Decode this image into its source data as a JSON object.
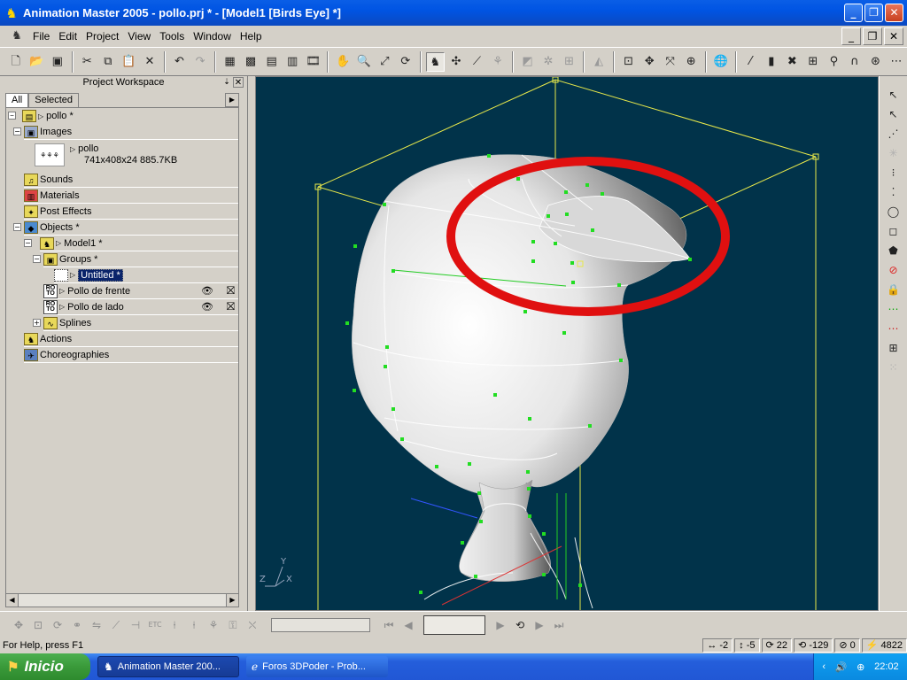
{
  "window": {
    "title": "Animation Master 2005 - pollo.prj * - [Model1 [Birds Eye] *]",
    "buttons": {
      "minimize": "_",
      "restore": "❐",
      "close": "✕"
    }
  },
  "menu": {
    "items": [
      "File",
      "Edit",
      "Project",
      "View",
      "Tools",
      "Window",
      "Help"
    ]
  },
  "workspace": {
    "title": "Project Workspace",
    "tabs": [
      "All",
      "Selected"
    ],
    "tree": {
      "project": "pollo *",
      "images": "Images",
      "image_name": "pollo",
      "image_info": "741x408x24 885.7KB",
      "sounds": "Sounds",
      "materials": "Materials",
      "post_effects": "Post Effects",
      "objects": "Objects *",
      "model": "Model1 *",
      "groups": "Groups *",
      "group_untitled": "Untitled *",
      "rotoscope1": "Pollo de frente",
      "rotoscope2": "Pollo de lado",
      "splines": "Splines",
      "actions": "Actions",
      "choreographies": "Choreographies"
    }
  },
  "statusbar": {
    "help": "For Help, press F1",
    "x": "-2",
    "y": "-5",
    "angle": "22",
    "roll": "-129",
    "pitch": "0",
    "count": "4822"
  },
  "taskbar": {
    "start": "Inicio",
    "tasks": [
      "Animation Master 200...",
      "Foros 3DPoder - Prob..."
    ],
    "clock": "22:02"
  },
  "colors": {
    "viewport_bg": "#01334a",
    "bounding_box": "#e8e84a",
    "cp_green": "#22dd22",
    "highlight_red": "#e01010",
    "title_blue": "#0054e3"
  }
}
